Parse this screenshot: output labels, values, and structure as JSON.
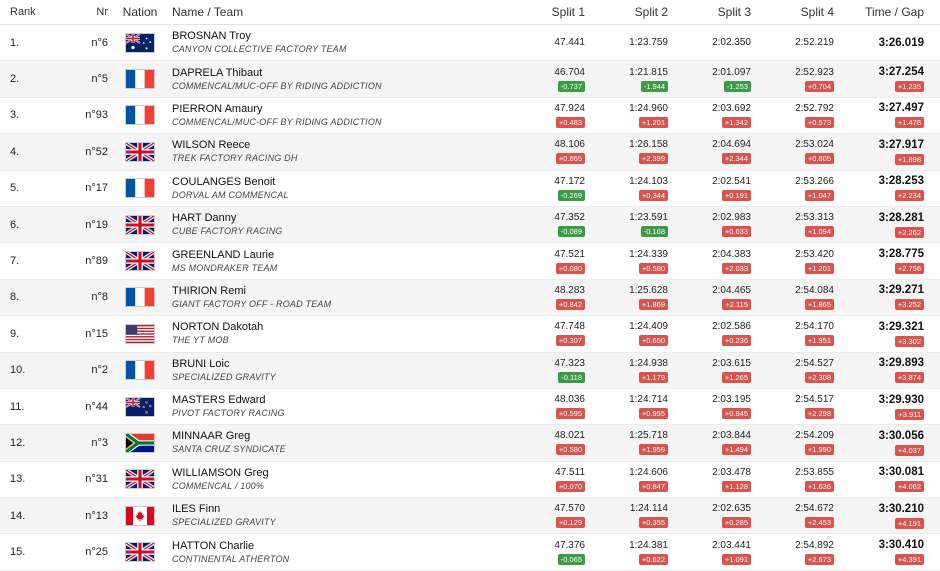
{
  "columns": {
    "rank": "Rank",
    "nr": "Nr",
    "nation": "Nation",
    "name_team": "Name / Team",
    "split1": "Split 1",
    "split2": "Split 2",
    "split3": "Split 3",
    "split4": "Split 4",
    "time_gap": "Time / Gap"
  },
  "colors": {
    "gap_behind": "#d9534f",
    "gap_ahead": "#3d9a45",
    "row_alt": "#f5f5f5"
  },
  "rows": [
    {
      "rank": "1.",
      "nr": "n°6",
      "flag": "aus",
      "name": "BROSNAN Troy",
      "team": "CANYON COLLECTIVE FACTORY TEAM",
      "splits": [
        {
          "t": "47.441",
          "g": "",
          "c": ""
        },
        {
          "t": "1:23.759",
          "g": "",
          "c": ""
        },
        {
          "t": "2:02.350",
          "g": "",
          "c": ""
        },
        {
          "t": "2:52.219",
          "g": "",
          "c": ""
        }
      ],
      "time": "3:26.019",
      "gap": "",
      "gapc": ""
    },
    {
      "rank": "2.",
      "nr": "n°5",
      "flag": "fra",
      "name": "DAPRELA Thibaut",
      "team": "COMMENCAL/MUC-OFF BY RIDING ADDICTION",
      "splits": [
        {
          "t": "46.704",
          "g": "-0.737",
          "c": "green"
        },
        {
          "t": "1:21.815",
          "g": "-1.944",
          "c": "green"
        },
        {
          "t": "2:01.097",
          "g": "-1.253",
          "c": "green"
        },
        {
          "t": "2:52.923",
          "g": "+0.704",
          "c": "red"
        }
      ],
      "time": "3:27.254",
      "gap": "+1.235",
      "gapc": "red"
    },
    {
      "rank": "3.",
      "nr": "n°93",
      "flag": "fra",
      "name": "PIERRON Amaury",
      "team": "COMMENCAL/MUC-OFF BY RIDING ADDICTION",
      "splits": [
        {
          "t": "47.924",
          "g": "+0.483",
          "c": "red"
        },
        {
          "t": "1:24.960",
          "g": "+1.201",
          "c": "red"
        },
        {
          "t": "2:03.692",
          "g": "+1.342",
          "c": "red"
        },
        {
          "t": "2:52.792",
          "g": "+0.573",
          "c": "red"
        }
      ],
      "time": "3:27.497",
      "gap": "+1.478",
      "gapc": "red"
    },
    {
      "rank": "4.",
      "nr": "n°52",
      "flag": "gbr",
      "name": "WILSON Reece",
      "team": "TREK FACTORY RACING DH",
      "splits": [
        {
          "t": "48.106",
          "g": "+0.665",
          "c": "red"
        },
        {
          "t": "1:26.158",
          "g": "+2.399",
          "c": "red"
        },
        {
          "t": "2:04.694",
          "g": "+2.344",
          "c": "red"
        },
        {
          "t": "2:53.024",
          "g": "+0.805",
          "c": "red"
        }
      ],
      "time": "3:27.917",
      "gap": "+1.898",
      "gapc": "red"
    },
    {
      "rank": "5.",
      "nr": "n°17",
      "flag": "fra",
      "name": "COULANGES Benoit",
      "team": "DORVAL AM COMMENCAL",
      "splits": [
        {
          "t": "47.172",
          "g": "-0.269",
          "c": "green"
        },
        {
          "t": "1:24.103",
          "g": "+0.344",
          "c": "red"
        },
        {
          "t": "2:02.541",
          "g": "+0.191",
          "c": "red"
        },
        {
          "t": "2:53.266",
          "g": "+1.047",
          "c": "red"
        }
      ],
      "time": "3:28.253",
      "gap": "+2.234",
      "gapc": "red"
    },
    {
      "rank": "6.",
      "nr": "n°19",
      "flag": "gbr",
      "name": "HART Danny",
      "team": "CUBE FACTORY RACING",
      "splits": [
        {
          "t": "47.352",
          "g": "-0.089",
          "c": "green"
        },
        {
          "t": "1:23.591",
          "g": "-0.168",
          "c": "green"
        },
        {
          "t": "2:02.983",
          "g": "+0.633",
          "c": "red"
        },
        {
          "t": "2:53.313",
          "g": "+1.094",
          "c": "red"
        }
      ],
      "time": "3:28.281",
      "gap": "+2.262",
      "gapc": "red"
    },
    {
      "rank": "7.",
      "nr": "n°89",
      "flag": "gbr",
      "name": "GREENLAND Laurie",
      "team": "MS MONDRAKER TEAM",
      "splits": [
        {
          "t": "47.521",
          "g": "+0.080",
          "c": "red"
        },
        {
          "t": "1:24.339",
          "g": "+0.580",
          "c": "red"
        },
        {
          "t": "2:04.383",
          "g": "+2.033",
          "c": "red"
        },
        {
          "t": "2:53.420",
          "g": "+1.201",
          "c": "red"
        }
      ],
      "time": "3:28.775",
      "gap": "+2.756",
      "gapc": "red"
    },
    {
      "rank": "8.",
      "nr": "n°8",
      "flag": "fra",
      "name": "THIRION Remi",
      "team": "GIANT FACTORY OFF - ROAD TEAM",
      "splits": [
        {
          "t": "48.283",
          "g": "+0.842",
          "c": "red"
        },
        {
          "t": "1:25.628",
          "g": "+1.869",
          "c": "red"
        },
        {
          "t": "2:04.465",
          "g": "+2.115",
          "c": "red"
        },
        {
          "t": "2:54.084",
          "g": "+1.865",
          "c": "red"
        }
      ],
      "time": "3:29.271",
      "gap": "+3.252",
      "gapc": "red"
    },
    {
      "rank": "9.",
      "nr": "n°15",
      "flag": "usa",
      "name": "NORTON Dakotah",
      "team": "THE YT MOB",
      "splits": [
        {
          "t": "47.748",
          "g": "+0.307",
          "c": "red"
        },
        {
          "t": "1:24.409",
          "g": "+0.650",
          "c": "red"
        },
        {
          "t": "2:02.586",
          "g": "+0.236",
          "c": "red"
        },
        {
          "t": "2:54.170",
          "g": "+1.951",
          "c": "red"
        }
      ],
      "time": "3:29.321",
      "gap": "+3.302",
      "gapc": "red"
    },
    {
      "rank": "10.",
      "nr": "n°2",
      "flag": "fra",
      "name": "BRUNI Loic",
      "team": "SPECIALIZED GRAVITY",
      "splits": [
        {
          "t": "47.323",
          "g": "-0.118",
          "c": "green"
        },
        {
          "t": "1:24.938",
          "g": "+1.179",
          "c": "red"
        },
        {
          "t": "2:03.615",
          "g": "+1.265",
          "c": "red"
        },
        {
          "t": "2:54.527",
          "g": "+2.308",
          "c": "red"
        }
      ],
      "time": "3:29.893",
      "gap": "+3.874",
      "gapc": "red"
    },
    {
      "rank": "11.",
      "nr": "n°44",
      "flag": "nzl",
      "name": "MASTERS Edward",
      "team": "PIVOT FACTORY RACING",
      "splits": [
        {
          "t": "48.036",
          "g": "+0.595",
          "c": "red"
        },
        {
          "t": "1:24.714",
          "g": "+0.955",
          "c": "red"
        },
        {
          "t": "2:03.195",
          "g": "+0.845",
          "c": "red"
        },
        {
          "t": "2:54.517",
          "g": "+2.298",
          "c": "red"
        }
      ],
      "time": "3:29.930",
      "gap": "+3.911",
      "gapc": "red"
    },
    {
      "rank": "12.",
      "nr": "n°3",
      "flag": "rsa",
      "name": "MINNAAR Greg",
      "team": "SANTA CRUZ SYNDICATE",
      "splits": [
        {
          "t": "48.021",
          "g": "+0.580",
          "c": "red"
        },
        {
          "t": "1:25.718",
          "g": "+1.959",
          "c": "red"
        },
        {
          "t": "2:03.844",
          "g": "+1.494",
          "c": "red"
        },
        {
          "t": "2:54.209",
          "g": "+1.990",
          "c": "red"
        }
      ],
      "time": "3:30.056",
      "gap": "+4.037",
      "gapc": "red"
    },
    {
      "rank": "13.",
      "nr": "n°31",
      "flag": "gbr",
      "name": "WILLIAMSON Greg",
      "team": "COMMENCAL / 100%",
      "splits": [
        {
          "t": "47.511",
          "g": "+0.070",
          "c": "red"
        },
        {
          "t": "1:24.606",
          "g": "+0.847",
          "c": "red"
        },
        {
          "t": "2:03.478",
          "g": "+1.128",
          "c": "red"
        },
        {
          "t": "2:53.855",
          "g": "+1.636",
          "c": "red"
        }
      ],
      "time": "3:30.081",
      "gap": "+4.062",
      "gapc": "red"
    },
    {
      "rank": "14.",
      "nr": "n°13",
      "flag": "can",
      "name": "ILES Finn",
      "team": "SPECIALIZED GRAVITY",
      "splits": [
        {
          "t": "47.570",
          "g": "+0.129",
          "c": "red"
        },
        {
          "t": "1:24.114",
          "g": "+0.355",
          "c": "red"
        },
        {
          "t": "2:02.635",
          "g": "+0.285",
          "c": "red"
        },
        {
          "t": "2:54.672",
          "g": "+2.453",
          "c": "red"
        }
      ],
      "time": "3:30.210",
      "gap": "+4.191",
      "gapc": "red"
    },
    {
      "rank": "15.",
      "nr": "n°25",
      "flag": "gbr",
      "name": "HATTON Charlie",
      "team": "CONTINENTAL ATHERTON",
      "splits": [
        {
          "t": "47.376",
          "g": "-0.065",
          "c": "green"
        },
        {
          "t": "1:24.381",
          "g": "+0.622",
          "c": "red"
        },
        {
          "t": "2:03.441",
          "g": "+1.091",
          "c": "red"
        },
        {
          "t": "2:54.892",
          "g": "+2.673",
          "c": "red"
        }
      ],
      "time": "3:30.410",
      "gap": "+4.391",
      "gapc": "red"
    }
  ]
}
